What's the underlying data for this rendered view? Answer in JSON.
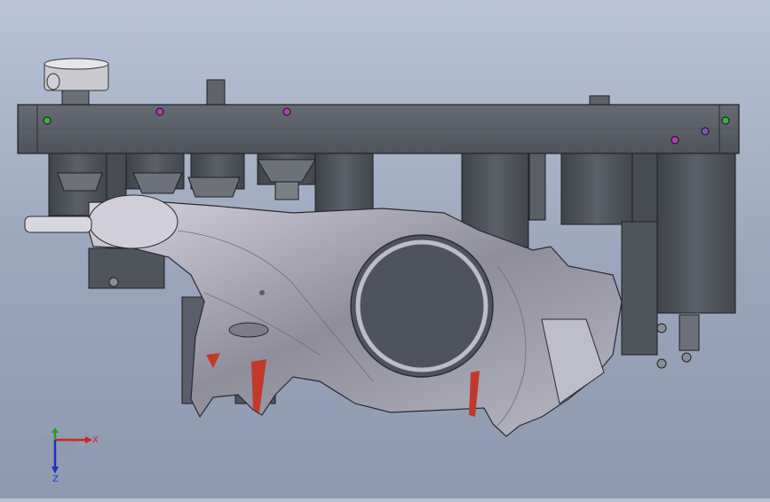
{
  "viewport": {
    "background_top": "#b9c3d6",
    "background_bottom": "#8e99b0"
  },
  "model": {
    "plate_color": "#5a5f68",
    "block_color": "#4e535b",
    "part_color": "#9a9aa6",
    "highlight_color": "#c7c6d2",
    "pad_color": "#c0392b",
    "marker_colors": [
      "#3cb043",
      "#b23bb0",
      "#b23bb0",
      "#b23bb0",
      "#7a5ab8",
      "#3cb043"
    ]
  },
  "triad": {
    "x_label": "X",
    "z_label": "Z",
    "x_color": "#d42020",
    "y_color": "#20a020",
    "z_color": "#2030c0"
  }
}
